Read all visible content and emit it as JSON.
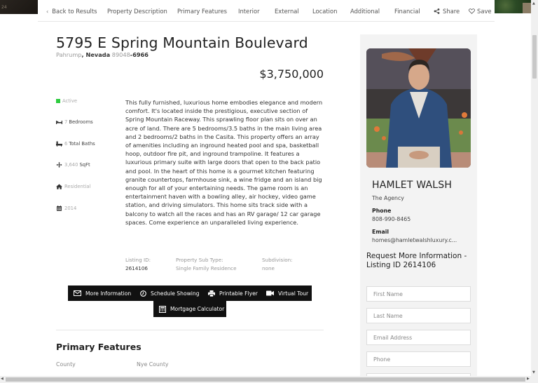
{
  "nav": {
    "back": "Back to Results",
    "items": [
      "Property Description",
      "Primary Features",
      "Interior",
      "External",
      "Location",
      "Additional",
      "Financial"
    ],
    "share": "Share",
    "save": "Save"
  },
  "listing": {
    "address": "5795 E Spring Mountain Boulevard",
    "city": "Pahrump",
    "state": "Nevada",
    "zip": "89048",
    "zip_ext": "-6966",
    "price": "$3,750,000",
    "status": "Active",
    "status_color": "#2ecc40",
    "bedrooms_num": "7",
    "bedrooms_label": "Bedrooms",
    "baths_num": "6",
    "baths_label": "Total Baths",
    "sqft_num": "3,640",
    "sqft_label": "SqFt",
    "type": "Residential",
    "year": "2014",
    "description": "This fully furnished, luxurious home embodies elegance and modern comfort. It's located inside the prestigious, executive section of Spring Mountain Raceway. This sprawling floor plan sits on over an acre of land. There are 5 bedrooms/3.5 baths in the main living area and 2 bedrooms/2 baths in the Casita. This property offers an array of amenities including an inground heated pool and spa, basketball hoop, outdoor fire pit, and inground trampoline. It features a luxurious primary suite with large doors that open to the back patio and pool. In the heart of this home is a gourmet kitchen featuring granite countertops, farmhouse sink, a wine fridge and an island big enough for all of your entertaining needs. The game room is an entertainment haven with a bowling alley, air hockey, video game station, and driving simulators. This home sits track side with a balcony to watch all the races and has an RV garage/ 12 car garage spaces. Come experience an unparalleled living experience.",
    "meta": [
      {
        "label": "Listing ID:",
        "value": "2614106"
      },
      {
        "label": "Property Sub Type:",
        "value": "Single Family Residence"
      },
      {
        "label": "Subdivision:",
        "value": "none"
      }
    ]
  },
  "actions": {
    "more_info": "More Information",
    "schedule": "Schedule Showing",
    "flyer": "Printable Flyer",
    "tour": "Virtual Tour",
    "mortgage": "Mortgage Calculator"
  },
  "primary_features": {
    "title": "Primary Features",
    "rows": [
      {
        "label": "County",
        "value": "Nye County"
      }
    ]
  },
  "agent": {
    "name": "HAMLET WALSH",
    "company": "The Agency",
    "phone_label": "Phone",
    "phone": "808-990-8465",
    "email_label": "Email",
    "email": "homes@hamletwalshluxury.c..."
  },
  "form": {
    "title": "Request More Information - Listing ID 2614106",
    "first_name_placeholder": "First Name",
    "last_name_placeholder": "Last Name",
    "email_placeholder": "Email Address",
    "phone_placeholder": "Phone"
  }
}
